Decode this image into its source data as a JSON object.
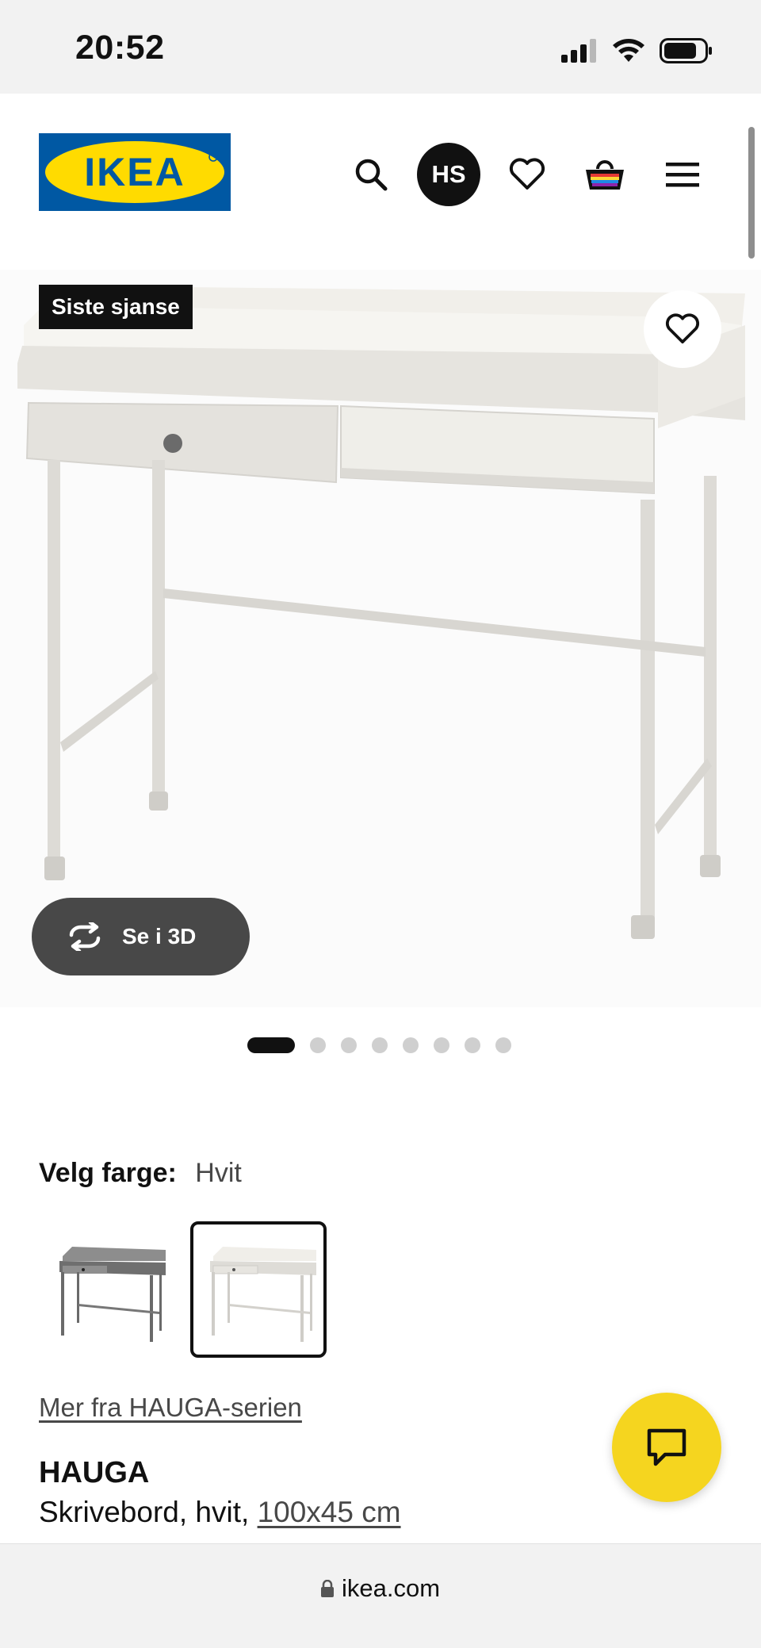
{
  "status_bar": {
    "time": "20:52",
    "icons": [
      "signal-icon",
      "wifi-icon",
      "battery-icon"
    ]
  },
  "header": {
    "logo_text": "IKEA",
    "avatar_initials": "HS",
    "icons": [
      "search-icon",
      "heart-icon",
      "basket-icon",
      "menu-icon"
    ]
  },
  "product_image": {
    "badge": "Siste sjanse",
    "view_3d_label": "Se i 3D",
    "carousel": {
      "count": 8,
      "active_index": 0
    }
  },
  "color_selection": {
    "label": "Velg farge:",
    "value": "Hvit",
    "options": [
      {
        "name": "Grå",
        "selected": false
      },
      {
        "name": "Hvit",
        "selected": true
      }
    ]
  },
  "product": {
    "series_link": "Mer fra HAUGA-serien",
    "name": "HAUGA",
    "description": "Skrivebord, hvit,",
    "dimensions": "100x45 cm"
  },
  "browser": {
    "url": "ikea.com"
  },
  "colors": {
    "ikea_blue": "#0058a3",
    "ikea_yellow": "#ffdb00",
    "chat_yellow": "#f5d51f",
    "dark_button": "#484848"
  }
}
